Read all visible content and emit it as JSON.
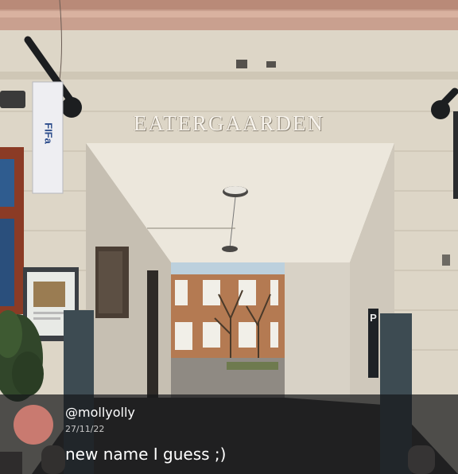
{
  "photo": {
    "building_sign": "EATERGAARDEN",
    "banner_text": "FIFa",
    "parking_sign": "P"
  },
  "post": {
    "username": "@mollyolly",
    "date": "27/11/22",
    "caption": "new name I guess ;)"
  },
  "colors": {
    "avatar": "#c97a70",
    "overlay": "#16181b"
  }
}
